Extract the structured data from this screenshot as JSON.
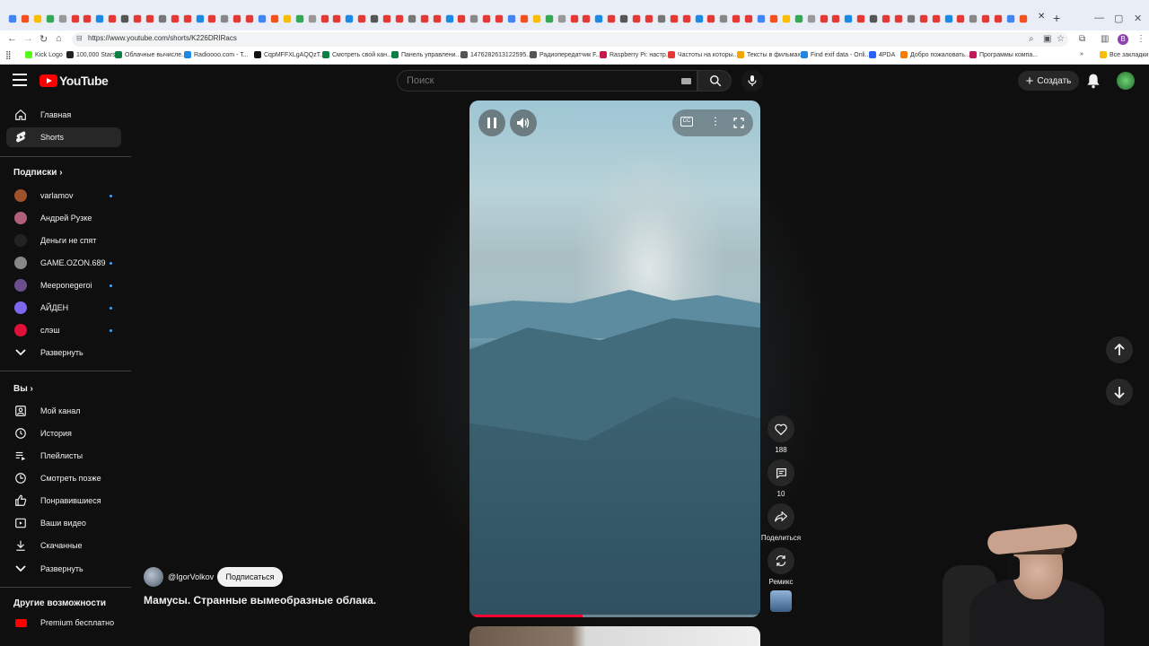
{
  "browser": {
    "url": "https://www.youtube.com/shorts/K226DRIRacs",
    "profile_letter": "B",
    "bookmarks": [
      "Kick Logo",
      "100,000 Stars",
      "Облачные вычисле...",
      "Radioooo.com - T...",
      "CqpMFFXLgAQQzT...",
      "Смотреть свой кан...",
      "Панель управлени...",
      "1476282613122595...",
      "Радиопередатчик F...",
      "Raspberry Pi: настр...",
      "Частоты на которы...",
      "Тексты в фильмах",
      "Find exif data - Onli...",
      "4PDA",
      "Добро пожаловать...",
      "Программы компа..."
    ],
    "all_bookmarks": "Все закладки"
  },
  "header": {
    "logo_text": "YouTube",
    "search_placeholder": "Поиск",
    "create_label": "Создать"
  },
  "sidebar": {
    "main": [
      {
        "label": "Главная",
        "icon": "home-icon"
      },
      {
        "label": "Shorts",
        "icon": "shorts-icon",
        "active": true
      }
    ],
    "subscriptions_header": "Подписки",
    "subscriptions": [
      {
        "label": "varlamov",
        "new": true,
        "color": "#a0522d"
      },
      {
        "label": "Андрей Рузке",
        "new": false,
        "color": "#b0607a"
      },
      {
        "label": "Деньги не спят",
        "new": false,
        "color": "#222222"
      },
      {
        "label": "GAME.OZON.689",
        "new": true,
        "color": "#888888"
      },
      {
        "label": "Meeponegeroi",
        "new": true,
        "color": "#6b4f8c"
      },
      {
        "label": "АЙДЕН",
        "new": true,
        "color": "#7b68ee"
      },
      {
        "label": "слэш",
        "new": true,
        "color": "#e0103a"
      }
    ],
    "subs_expand": "Развернуть",
    "you_header": "Вы",
    "you": [
      {
        "label": "Мой канал",
        "icon": "channel-icon"
      },
      {
        "label": "История",
        "icon": "history-icon"
      },
      {
        "label": "Плейлисты",
        "icon": "playlists-icon"
      },
      {
        "label": "Смотреть позже",
        "icon": "watch-later-icon"
      },
      {
        "label": "Понравившиеся",
        "icon": "like-icon"
      },
      {
        "label": "Ваши видео",
        "icon": "your-videos-icon"
      },
      {
        "label": "Скачанные",
        "icon": "download-icon"
      }
    ],
    "you_expand": "Развернуть",
    "more_header": "Другие возможности",
    "premium_label": "Premium бесплатно"
  },
  "short": {
    "channel": "@IgorVolkov",
    "subscribe_label": "Подписаться",
    "title": "Мамусы. Странные вымеобразные облака.",
    "progress_fraction": 0.39,
    "likes": "188",
    "comments": "10",
    "share_label": "Поделиться",
    "remix_label": "Ремикс"
  },
  "colors": {
    "accent_red": "#ff0000",
    "progress": "#ff0033",
    "new_dot": "#3ea6ff"
  }
}
